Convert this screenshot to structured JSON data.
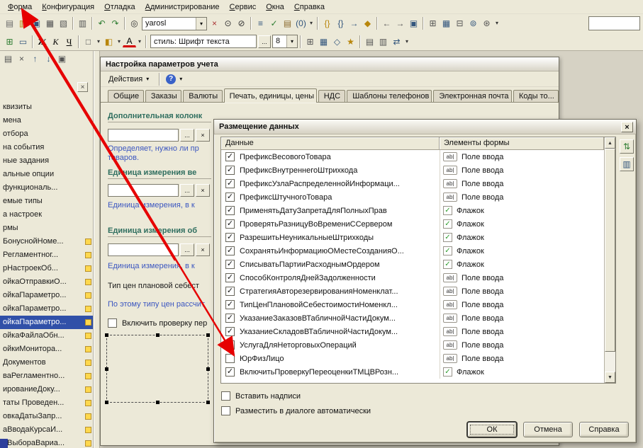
{
  "glyphs": {
    "up": "▲",
    "down": "▼",
    "left": "◄",
    "right": "►",
    "close": "×",
    "caret": "▾",
    "check": "✓",
    "help": "?"
  },
  "menubar": {
    "items": [
      {
        "n": "menu-forma",
        "label": "Форма"
      },
      {
        "n": "menu-konfiguratsiya",
        "label": "Конфигурация"
      },
      {
        "n": "menu-otladka",
        "label": "Отладка"
      },
      {
        "n": "menu-administrirovanie",
        "label": "Администрирование"
      },
      {
        "n": "menu-servis",
        "label": "Сервис"
      },
      {
        "n": "menu-okna",
        "label": "Окна"
      },
      {
        "n": "menu-spravka",
        "label": "Справка"
      }
    ]
  },
  "toolbar_main": {
    "search_value": "yarosl",
    "icons_a": [
      {
        "n": "new-document-icon",
        "g": "▤",
        "c": "#6b6b6b"
      },
      {
        "n": "open-icon",
        "g": "▥",
        "c": "#b8860b"
      },
      {
        "n": "save-icon",
        "g": "▣",
        "c": "#33567d"
      },
      {
        "n": "print-icon",
        "g": "▦",
        "c": "#555555"
      },
      {
        "n": "print-preview-icon",
        "g": "▧",
        "c": "#555555"
      },
      {
        "sep": 1
      },
      {
        "n": "copy-icon",
        "g": "▥",
        "c": "#555555"
      },
      {
        "sep": 1
      },
      {
        "n": "undo-icon",
        "g": "↶",
        "c": "#2e7d32"
      },
      {
        "n": "redo-icon",
        "g": "↷",
        "c": "#2e7d32"
      },
      {
        "sep": 1
      },
      {
        "n": "find-icon",
        "g": "◎",
        "c": "#333333"
      }
    ],
    "icons_b": [
      {
        "n": "clear-search-icon",
        "g": "×",
        "c": "#aa3333"
      },
      {
        "n": "search-next-icon",
        "g": "⊙",
        "c": "#333333"
      },
      {
        "n": "search-scope-icon",
        "g": "⊘",
        "c": "#333333"
      },
      {
        "sep": 1
      },
      {
        "n": "procedures-list-icon",
        "g": "≡",
        "c": "#33567d"
      },
      {
        "n": "syntax-check-icon",
        "g": "✓",
        "c": "#2e7d32"
      },
      {
        "n": "clipboard-icon",
        "g": "▤",
        "c": "#8b6b2e"
      },
      {
        "n": "counter-icon",
        "g": "(0)",
        "c": "#33567d"
      },
      {
        "n": "chevron-down-icon",
        "g": "▾",
        "caret": 1,
        "c": "#333333"
      },
      {
        "sep": 1
      },
      {
        "n": "template-braces-icon",
        "g": "{}",
        "c": "#b8860b"
      },
      {
        "n": "procedure-braces-icon",
        "g": "{}",
        "c": "#33567d"
      },
      {
        "n": "goto-definition-icon",
        "g": "→",
        "c": "#33567d"
      },
      {
        "n": "bookmark-icon",
        "g": "◆",
        "c": "#b8860b"
      },
      {
        "sep": 1
      },
      {
        "n": "back-icon",
        "g": "←",
        "c": "#555555"
      },
      {
        "n": "forward-icon",
        "g": "→",
        "c": "#555555"
      },
      {
        "n": "open-module-icon",
        "g": "▣",
        "c": "#33567d"
      },
      {
        "sep": 1
      },
      {
        "n": "split-window-icon",
        "g": "⊞",
        "c": "#555555"
      },
      {
        "n": "table-icon",
        "g": "▦",
        "c": "#33567d"
      },
      {
        "n": "calculator-icon",
        "g": "⊟",
        "c": "#555555"
      },
      {
        "n": "globe-icon",
        "g": "⊚",
        "c": "#33567d"
      },
      {
        "n": "settings-gear-icon",
        "g": "⊛",
        "c": "#555555"
      },
      {
        "n": "chevron-down-icon",
        "g": "▾",
        "caret": 1,
        "c": "#333333"
      }
    ]
  },
  "toolbar_format": {
    "style_value": "стиль: Шрифт текста",
    "ellipsis": "...",
    "font_size": "8",
    "icons_a": [
      {
        "n": "insert-control-icon",
        "g": "⊞",
        "c": "#2e7d32"
      },
      {
        "n": "insert-field-icon",
        "g": "▭",
        "c": "#33567d"
      },
      {
        "sep": 1
      },
      {
        "n": "bold-icon",
        "g": "Ж",
        "b": 1,
        "c": "#000000"
      },
      {
        "n": "italic-icon",
        "g": "К",
        "i": 1,
        "c": "#000000"
      },
      {
        "n": "underline-icon",
        "g": "Ч",
        "u": 1,
        "c": "#000000"
      },
      {
        "sep": 1
      },
      {
        "n": "borders-icon",
        "g": "□",
        "c": "#555555"
      },
      {
        "n": "chevron-down-icon",
        "g": "▾",
        "caret": 1,
        "c": "#333333"
      },
      {
        "n": "fill-color-icon",
        "g": "◧",
        "c": "#b8860b"
      },
      {
        "n": "chevron-down-icon",
        "g": "▾",
        "caret": 1,
        "c": "#333333"
      },
      {
        "n": "font-color-icon",
        "g": "А",
        "red": 1,
        "c": "#000000"
      },
      {
        "n": "chevron-down-icon",
        "g": "▾",
        "caret": 1,
        "c": "#333333"
      },
      {
        "sep": 1
      }
    ],
    "icons_b": [
      {
        "sep": 1
      },
      {
        "n": "grid-icon",
        "g": "⊞",
        "c": "#555555"
      },
      {
        "n": "align-icon",
        "g": "▦",
        "c": "#33567d"
      },
      {
        "n": "snap-icon",
        "g": "◇",
        "c": "#33567d"
      },
      {
        "n": "wand-icon",
        "g": "★",
        "c": "#b8860b"
      },
      {
        "sep": 1
      },
      {
        "n": "align-left-icon",
        "g": "▤",
        "c": "#555555"
      },
      {
        "n": "align-top-icon",
        "g": "▥",
        "c": "#555555"
      },
      {
        "n": "tab-order-icon",
        "g": "⇄",
        "c": "#33567d"
      },
      {
        "n": "chevron-down-icon",
        "g": "▾",
        "caret": 1,
        "c": "#333333"
      }
    ]
  },
  "sidebar": {
    "toolbar": [
      {
        "n": "panel-list-icon",
        "g": "▤",
        "c": "#555555"
      },
      {
        "n": "panel-close-icon",
        "g": "×",
        "c": "#555555"
      },
      {
        "n": "move-up-icon",
        "g": "↑",
        "c": "#33567d"
      },
      {
        "n": "move-down-icon",
        "g": "↓",
        "c": "#33567d"
      },
      {
        "n": "panel-window-icon",
        "g": "▣",
        "c": "#555555"
      }
    ],
    "items": [
      {
        "label": "квизиты"
      },
      {
        "label": "мена"
      },
      {
        "label": "отбора"
      },
      {
        "label": "на события"
      },
      {
        "label": "ные задания"
      },
      {
        "label": "альные опции"
      },
      {
        "label": "функциональ..."
      },
      {
        "label": "емые типы"
      },
      {
        "label": "а настроек"
      },
      {
        "label": "рмы"
      },
      {
        "label": "БонуснойНоме...",
        "locked": 1
      },
      {
        "label": "Регламентног...",
        "locked": 1
      },
      {
        "label": "рНастроекОб...",
        "locked": 1
      },
      {
        "label": "ойкаОтправкиО...",
        "locked": 1
      },
      {
        "label": "ойкаПараметро...",
        "locked": 1
      },
      {
        "label": "ойкаПараметро...",
        "locked": 1
      },
      {
        "label": "ойкаПараметро...",
        "locked": 1,
        "selected": 1
      },
      {
        "label": "ойкаФайлаОбн...",
        "locked": 1
      },
      {
        "label": "ойкиМонитора...",
        "locked": 1
      },
      {
        "label": "Документов",
        "locked": 1
      },
      {
        "label": "ваРегламентно...",
        "locked": 1
      },
      {
        "label": "ированиеДоку...",
        "locked": 1
      },
      {
        "label": "таты Проведен...",
        "locked": 1
      },
      {
        "label": "овкаДатыЗапр...",
        "locked": 1
      },
      {
        "label": "аВводаКурсаИ...",
        "locked": 1
      },
      {
        "label": "аВыбораВариа...",
        "locked": 1
      }
    ]
  },
  "main_window": {
    "title": "Настройка параметров учета",
    "actions_label": "Действия",
    "tabs": [
      {
        "n": "tab-general",
        "label": "Общие"
      },
      {
        "n": "tab-orders",
        "label": "Заказы"
      },
      {
        "n": "tab-currencies",
        "label": "Валюты"
      },
      {
        "n": "tab-print-units-prices",
        "label": "Печать, единицы, цены",
        "active": 1
      },
      {
        "n": "tab-vat",
        "label": "НДС"
      },
      {
        "n": "tab-phone-templates",
        "label": "Шаблоны телефонов"
      },
      {
        "n": "tab-email",
        "label": "Электронная почта"
      },
      {
        "n": "tab-codes",
        "label": "Коды то..."
      }
    ],
    "form": {
      "group1_title": "Дополнительная колонк",
      "group1_desc1": "Определяет, нужно ли пр",
      "group1_desc2": "товаров.",
      "group2_title": "Единица измерения ве",
      "group2_desc": "Единица измерения, в к",
      "group3_title": "Единица измерения об",
      "group3_desc": "Единица измерения, в к",
      "price_type_label": "Тип цен плановой себест",
      "price_type_desc": "По этому типу цен рассчит",
      "check_label": "Включить проверку пер"
    }
  },
  "dialog": {
    "title": "Размещение данных",
    "columns": [
      "Данные",
      "Элементы формы"
    ],
    "icons": {
      "input_badge": "ab"
    },
    "side_buttons": [
      {
        "n": "mark-all-button",
        "g": "⇅",
        "c": "#2e7d32"
      },
      {
        "n": "columns-button",
        "g": "▥",
        "c": "#33567d"
      }
    ],
    "rows": [
      {
        "name": "ПрефиксВесовогоТовара",
        "element": "Поле ввода",
        "checked": 1,
        "input": 1
      },
      {
        "name": "ПрефиксВнутреннегоШтрихкода",
        "element": "Поле ввода",
        "checked": 1,
        "input": 1
      },
      {
        "name": "ПрефиксУзлаРаспределеннойИнформаци...",
        "element": "Поле ввода",
        "checked": 1,
        "input": 1
      },
      {
        "name": "ПрефиксШтучногоТовара",
        "element": "Поле ввода",
        "checked": 1,
        "input": 1
      },
      {
        "name": "ПрименятьДатуЗапретаДляПолныхПрав",
        "element": "Флажок",
        "checked": 1
      },
      {
        "name": "ПроверятьРазницуВоВремениССервером",
        "element": "Флажок",
        "checked": 1
      },
      {
        "name": "РазрешитьНеуникальныеШтрихкоды",
        "element": "Флажок",
        "checked": 1
      },
      {
        "name": "СохранятьИнформациюОМестеСозданияО...",
        "element": "Флажок",
        "checked": 1
      },
      {
        "name": "СписыватьПартииРасходнымОрдером",
        "element": "Флажок",
        "checked": 1
      },
      {
        "name": "СпособКонтроляДнейЗадолженности",
        "element": "Поле ввода",
        "checked": 1,
        "input": 1
      },
      {
        "name": "СтратегияАвторезервированияНоменклат...",
        "element": "Поле ввода",
        "checked": 1,
        "input": 1
      },
      {
        "name": "ТипЦенПлановойСебестоимостиНоменкл...",
        "element": "Поле ввода",
        "checked": 1,
        "input": 1
      },
      {
        "name": "УказаниеЗаказовВТабличнойЧастиДокум...",
        "element": "Поле ввода",
        "checked": 1,
        "input": 1
      },
      {
        "name": "УказаниеСкладовВТабличнойЧастиДокум...",
        "element": "Поле ввода",
        "checked": 1,
        "input": 1
      },
      {
        "name": "УслугаДляНеторговыхОпераций",
        "element": "Поле ввода",
        "checked": 1,
        "input": 1
      },
      {
        "name": "ЮрФизЛицо",
        "element": "Поле ввода",
        "checked": 0,
        "input": 1
      },
      {
        "name": "ВключитьПроверкуПереоценкиТМЦВРозн...",
        "element": "Флажок",
        "checked": 1
      }
    ],
    "insert_labels_label": "Вставить надписи",
    "auto_place_label": "Разместить в диалоге автоматически",
    "buttons": [
      {
        "n": "ok-button",
        "label": "ОК",
        "default": 1
      },
      {
        "n": "cancel-button",
        "label": "Отмена"
      },
      {
        "n": "help-button",
        "label": "Справка"
      }
    ]
  }
}
